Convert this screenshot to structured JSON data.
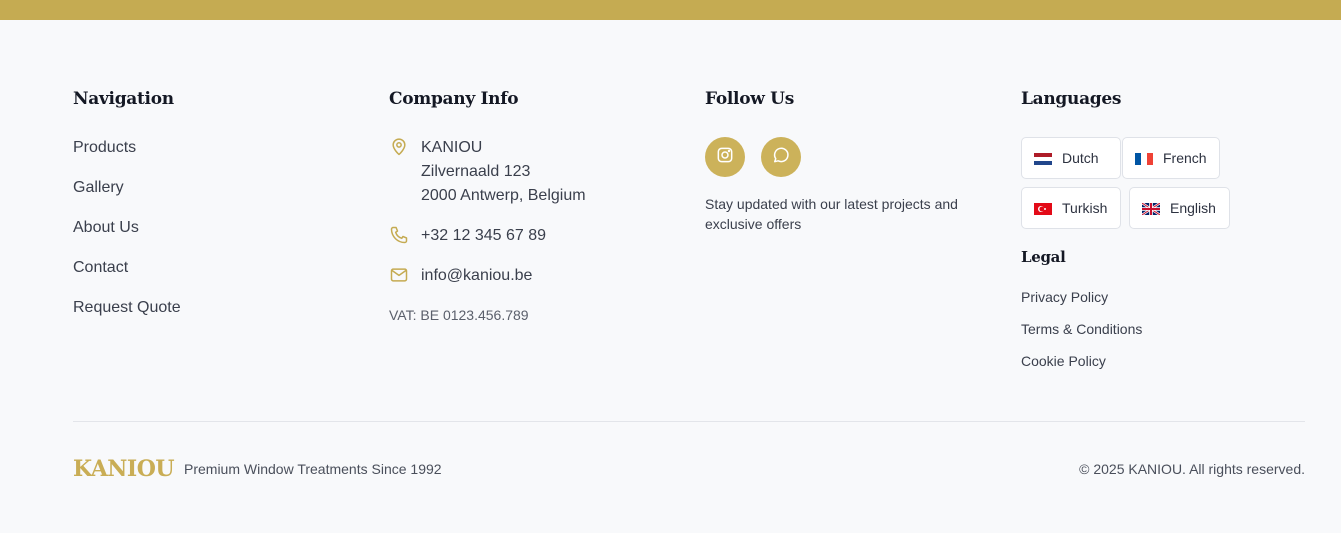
{
  "navigation": {
    "title": "Navigation",
    "items": [
      "Products",
      "Gallery",
      "About Us",
      "Contact",
      "Request Quote"
    ]
  },
  "company": {
    "title": "Company Info",
    "address": [
      "KANIOU",
      "Zilvernaald 123",
      "2000 Antwerp, Belgium"
    ],
    "phone": "+32 12 345 67 89",
    "email": "info@kaniou.be",
    "vat": "VAT: BE 0123.456.789",
    "icons": [
      "map-pin-icon",
      "phone-icon",
      "mail-icon"
    ]
  },
  "follow": {
    "title": "Follow Us",
    "icons": [
      "instagram-icon",
      "chat-bubble-icon"
    ],
    "text": "Stay updated with our latest projects and exclusive offers"
  },
  "languages": {
    "title": "Languages",
    "items": [
      {
        "label": "Dutch",
        "flag": "nl"
      },
      {
        "label": "French",
        "flag": "fr"
      },
      {
        "label": "Turkish",
        "flag": "tr"
      },
      {
        "label": "English",
        "flag": "gb"
      }
    ]
  },
  "legal": {
    "title": "Legal",
    "items": [
      "Privacy Policy",
      "Terms & Conditions",
      "Cookie Policy"
    ]
  },
  "footer": {
    "brand": "KANIOU",
    "tagline": "Premium Window Treatments Since 1992",
    "copyright": "© 2025 KANIOU. All rights reserved."
  },
  "colors": {
    "accent": "#c5ab52",
    "background": "#f8f9fb",
    "heading": "#141824"
  }
}
